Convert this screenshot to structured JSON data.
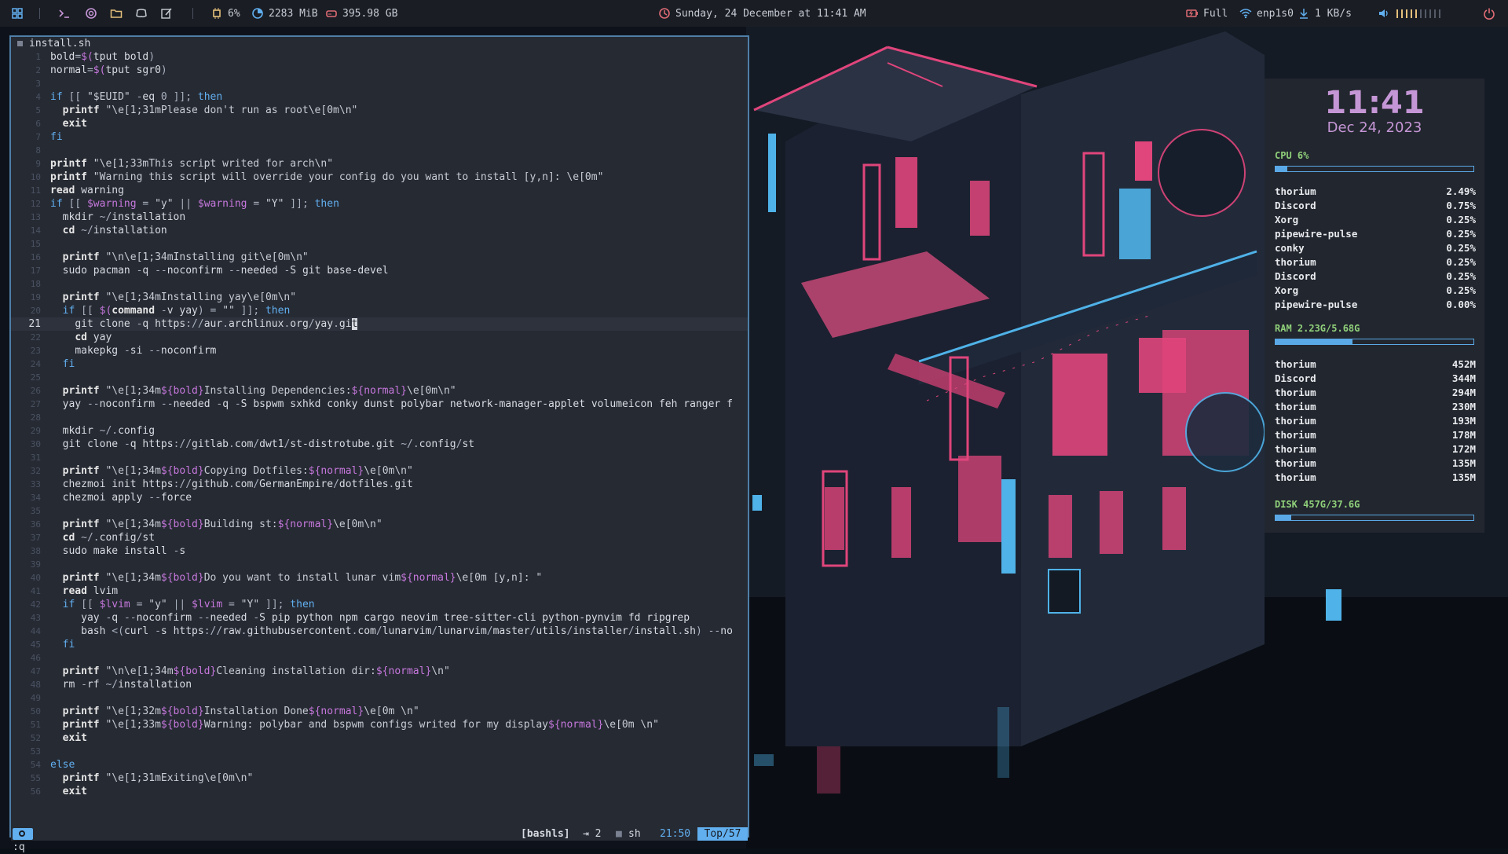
{
  "topbar": {
    "cpu": "6%",
    "memory": "2283 MiB",
    "disk": "395.98 GB",
    "datetime": "Sunday, 24 December at 11:41 AM",
    "battery": "Full",
    "network_iface": "enp1s0",
    "network_speed": "1 KB/s"
  },
  "editor": {
    "filename": "install.sh",
    "lines": [
      "bold=$(tput bold)",
      "normal=$(tput sgr0)",
      "",
      "if [[ \"$EUID\" -eq 0 ]]; then",
      "  printf \"\\e[1;31mPlease don't run as root\\e[0m\\n\"",
      "  exit",
      "fi",
      "",
      "printf \"\\e[1;33mThis script writed for arch\\n\"",
      "printf \"Warning this script will override your config do you want to install [y,n]: \\e[0m\"",
      "read warning",
      "if [[ $warning = \"y\" || $warning = \"Y\" ]]; then",
      "  mkdir ~/installation",
      "  cd ~/installation",
      "",
      "  printf \"\\n\\e[1;34mInstalling git\\e[0m\\n\"",
      "  sudo pacman -q --noconfirm --needed -S git base-devel",
      "",
      "  printf \"\\e[1;34mInstalling yay\\e[0m\\n\"",
      "  if [[ $(command -v yay) = \"\" ]]; then",
      "    git clone -q https://aur.archlinux.org/yay.git",
      "    cd yay",
      "    makepkg -si --noconfirm",
      "  fi",
      "",
      "  printf \"\\e[1;34m${bold}Installing Dependencies:${normal}\\e[0m\\n\"",
      "  yay --noconfirm --needed -q -S bspwm sxhkd conky dunst polybar network-manager-applet volumeicon feh ranger f",
      "",
      "  mkdir ~/.config",
      "  git clone -q https://gitlab.com/dwt1/st-distrotube.git ~/.config/st",
      "",
      "  printf \"\\e[1;34m${bold}Copying Dotfiles:${normal}\\e[0m\\n\"",
      "  chezmoi init https://github.com/GermanEmpire/dotfiles.git",
      "  chezmoi apply --force",
      "",
      "  printf \"\\e[1;34m${bold}Building st:${normal}\\e[0m\\n\"",
      "  cd ~/.config/st",
      "  sudo make install -s",
      "",
      "  printf \"\\e[1;34m${bold}Do you want to install lunar vim${normal}\\e[0m [y,n]: \"",
      "  read lvim",
      "  if [[ $lvim = \"y\" || $lvim = \"Y\" ]]; then",
      "     yay -q --noconfirm --needed -S pip python npm cargo neovim tree-sitter-cli python-pynvim fd ripgrep",
      "     bash <(curl -s https://raw.githubusercontent.com/lunarvim/lunarvim/master/utils/installer/install.sh) --no",
      "  fi",
      "",
      "  printf \"\\n\\e[1;34m${bold}Cleaning installation dir:${normal}\\n\"",
      "  rm -rf ~/installation",
      "",
      "  printf \"\\e[1;32m${bold}Installation Done${normal}\\e[0m \\n\"",
      "  printf \"\\e[1;33m${bold}Warning: polybar and bspwm configs writed for my display${normal}\\e[0m \\n\"",
      "  exit",
      "",
      "else",
      "  printf \"\\e[1;31mExiting\\e[0m\\n\"",
      "  exit"
    ],
    "current_line": 21,
    "status": {
      "filetype": "[bashls]",
      "indent": "⇥ 2",
      "shell": "sh",
      "cursor_pos": "21:50",
      "scroll": "Top/57"
    },
    "command": ":q"
  },
  "conky": {
    "time": "11:41",
    "date": "Dec 24, 2023",
    "cpu_label": "CPU  6%",
    "cpu_fraction": 0.06,
    "cpu_procs": [
      {
        "name": "thorium",
        "value": "2.49%"
      },
      {
        "name": "Discord",
        "value": "0.75%"
      },
      {
        "name": "Xorg",
        "value": "0.25%"
      },
      {
        "name": "pipewire-pulse",
        "value": "0.25%"
      },
      {
        "name": "conky",
        "value": "0.25%"
      },
      {
        "name": "thorium",
        "value": "0.25%"
      },
      {
        "name": "Discord",
        "value": "0.25%"
      },
      {
        "name": "Xorg",
        "value": "0.25%"
      },
      {
        "name": "pipewire-pulse",
        "value": "0.00%"
      }
    ],
    "ram_label": "RAM  2.23G/5.68G",
    "ram_fraction": 0.39,
    "ram_procs": [
      {
        "name": "thorium",
        "value": "452M"
      },
      {
        "name": "Discord",
        "value": "344M"
      },
      {
        "name": "thorium",
        "value": "294M"
      },
      {
        "name": "thorium",
        "value": "230M"
      },
      {
        "name": "thorium",
        "value": "193M"
      },
      {
        "name": "thorium",
        "value": "178M"
      },
      {
        "name": "thorium",
        "value": "172M"
      },
      {
        "name": "thorium",
        "value": "135M"
      },
      {
        "name": "thorium",
        "value": "135M"
      }
    ],
    "disk_label": "DISK  457G/37.6G",
    "disk_fraction": 0.08
  },
  "colors": {
    "accent": "#61afef",
    "conky_purple": "#c596d6",
    "conky_green": "#8fd07a",
    "neon_pink": "#e0457b",
    "neon_blue": "#4fb2e8"
  }
}
